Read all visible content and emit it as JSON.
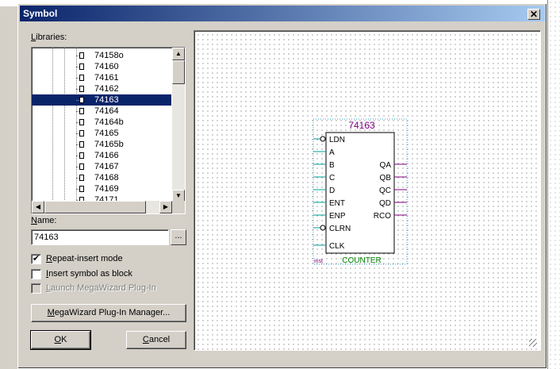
{
  "dialog": {
    "title": "Symbol",
    "close_glyph": "✕",
    "libraries_label": "Libraries:",
    "name_label": "Name:",
    "name_value": "74163",
    "browse_label": "...",
    "ok_label": "OK",
    "cancel_label": "Cancel",
    "megawizard_button": "MegaWizard Plug-In Manager..."
  },
  "libraries": {
    "items": [
      "74158o",
      "74160",
      "74161",
      "74162",
      "74163",
      "74164",
      "74164b",
      "74165",
      "74165b",
      "74166",
      "74167",
      "74168",
      "74169",
      "74171"
    ],
    "selected": "74163"
  },
  "options": {
    "repeat_insert": {
      "label": "Repeat-insert mode",
      "checked": true
    },
    "insert_as_block": {
      "label": "Insert symbol as block",
      "checked": false
    },
    "launch_megawizard": {
      "label": "Launch MegaWizard Plug-In",
      "checked": false,
      "disabled": true
    }
  },
  "symbol": {
    "name": "74163",
    "inputs": [
      "LDN",
      "A",
      "B",
      "C",
      "D",
      "ENT",
      "ENP",
      "CLRN",
      "CLK"
    ],
    "outputs": [
      "QA",
      "QB",
      "QC",
      "QD",
      "RCO"
    ],
    "inst_label": "inst",
    "type_label": "COUNTER"
  },
  "colors": {
    "title_start": "#0a246a",
    "title_end": "#a6caf0",
    "selection": "#0a246a",
    "symbol_name": "#800080",
    "symbol_type": "#008000",
    "pin_line": "#00a0a0",
    "output_line": "#800080"
  }
}
